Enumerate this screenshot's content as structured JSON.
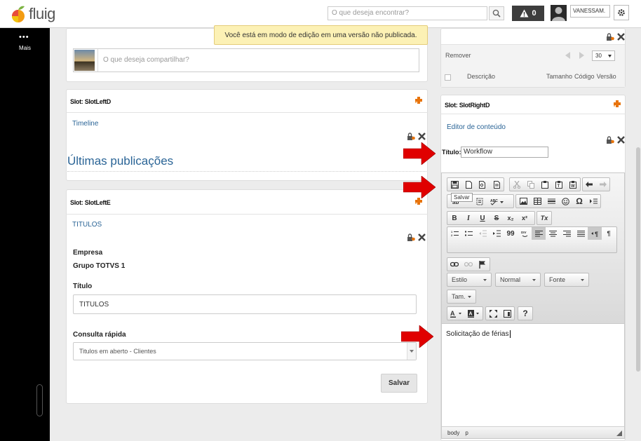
{
  "header": {
    "logo_text": "fluig",
    "search_placeholder": "O que deseja encontrar?",
    "alert_count": "0",
    "user_name": "VANESSAM."
  },
  "sidebar": {
    "more_label": "Mais"
  },
  "notice": "Você está em modo de edição em uma versão não publicada.",
  "share": {
    "placeholder": "O que deseja compartilhar?"
  },
  "slot_left_d": {
    "title": "Slot: SlotLeftD",
    "widget_link": "Timeline",
    "heading": "Últimas publicações"
  },
  "slot_left_e": {
    "title": "Slot: SlotLeftE",
    "widget_link": "TITULOS",
    "company_label": "Empresa",
    "company_value": "Grupo TOTVS 1",
    "title_label": "Título",
    "title_value": "TITULOS",
    "quick_label": "Consulta rápida",
    "quick_value": "Titulos em aberto - Clientes",
    "save_label": "Salvar"
  },
  "docs_panel": {
    "remove_label": "Remover",
    "page_size": "30",
    "col_description": "Descrição",
    "col_size": "Tamanho",
    "col_code": "Código",
    "col_version": "Versão"
  },
  "slot_right_d": {
    "title": "Slot: SlotRightD",
    "widget_link": "Editor de conteúdo",
    "title_label": "Título:",
    "title_value": "Workflow"
  },
  "editor": {
    "tooltip": "Salvar",
    "style_combo": "Estilo",
    "format_combo": "Normal",
    "font_combo": "Fonte",
    "size_combo": "Tam.",
    "content": "Solicitação de férias",
    "path_body": "body",
    "path_p": "p",
    "bold": "B",
    "italic": "I",
    "underline": "U",
    "strike": "S",
    "subscript": "x₂",
    "superscript": "x²",
    "remove_format": "Tx",
    "blockquote": "99",
    "pilcrow": "¶",
    "help": "?",
    "omega": "Ω"
  },
  "colors": {
    "link": "#2a6496",
    "notice_bg": "#fcf1b5",
    "arrow": "#e00000",
    "sidebar": "#000000",
    "plus_icon": "#e8740c"
  }
}
